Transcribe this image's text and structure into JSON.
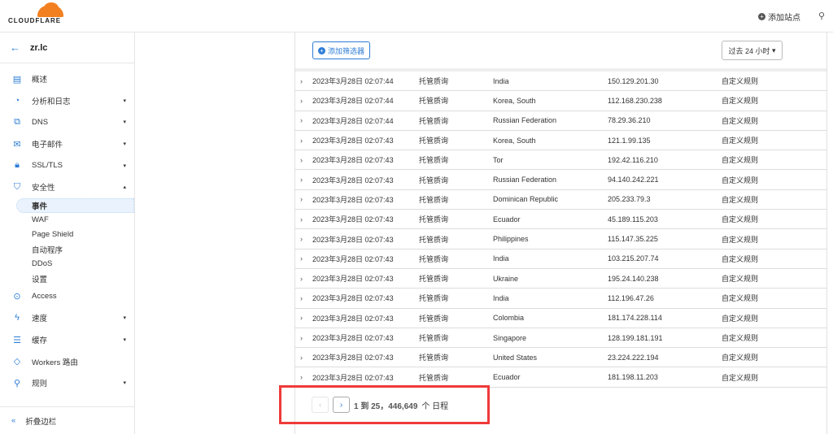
{
  "header": {
    "logo_text": "CLOUDFLARE",
    "add_site": "添加站点",
    "search_icon": "search-icon"
  },
  "sidebar": {
    "zone": "zr.lc",
    "items": [
      {
        "label": "概述",
        "icon": "document-icon",
        "caret": false
      },
      {
        "label": "分析和日志",
        "icon": "chart-pie-icon",
        "caret": true
      },
      {
        "label": "DNS",
        "icon": "network-icon",
        "caret": true
      },
      {
        "label": "电子邮件",
        "icon": "email-icon",
        "caret": true
      },
      {
        "label": "SSL/TLS",
        "icon": "lock-icon",
        "caret": true
      },
      {
        "label": "安全性",
        "icon": "shield-icon",
        "caret": true
      }
    ],
    "security_sub": [
      "事件",
      "WAF",
      "Page Shield",
      "自动程序",
      "DDoS",
      "设置"
    ],
    "items2": [
      {
        "label": "Access",
        "icon": "access-icon",
        "caret": false
      },
      {
        "label": "速度",
        "icon": "lightning-icon",
        "caret": true
      },
      {
        "label": "缓存",
        "icon": "cache-icon",
        "caret": true
      },
      {
        "label": "Workers 路由",
        "icon": "workers-icon",
        "caret": false
      },
      {
        "label": "规则",
        "icon": "rules-icon",
        "caret": true
      }
    ],
    "collapse": "折叠边栏"
  },
  "main": {
    "add_filter": "添加筛选器",
    "time_range": "过去 24 小时",
    "rows": [
      [
        "2023年3月28日 02:07:44",
        "托管质询",
        "India",
        "150.129.201.30",
        "自定义规则"
      ],
      [
        "2023年3月28日 02:07:44",
        "托管质询",
        "Korea, South",
        "112.168.230.238",
        "自定义规则"
      ],
      [
        "2023年3月28日 02:07:44",
        "托管质询",
        "Russian Federation",
        "78.29.36.210",
        "自定义规则"
      ],
      [
        "2023年3月28日 02:07:43",
        "托管质询",
        "Korea, South",
        "121.1.99.135",
        "自定义规则"
      ],
      [
        "2023年3月28日 02:07:43",
        "托管质询",
        "Tor",
        "192.42.116.210",
        "自定义规则"
      ],
      [
        "2023年3月28日 02:07:43",
        "托管质询",
        "Russian Federation",
        "94.140.242.221",
        "自定义规则"
      ],
      [
        "2023年3月28日 02:07:43",
        "托管质询",
        "Dominican Republic",
        "205.233.79.3",
        "自定义规则"
      ],
      [
        "2023年3月28日 02:07:43",
        "托管质询",
        "Ecuador",
        "45.189.115.203",
        "自定义规则"
      ],
      [
        "2023年3月28日 02:07:43",
        "托管质询",
        "Philippines",
        "115.147.35.225",
        "自定义规则"
      ],
      [
        "2023年3月28日 02:07:43",
        "托管质询",
        "India",
        "103.215.207.74",
        "自定义规则"
      ],
      [
        "2023年3月28日 02:07:43",
        "托管质询",
        "Ukraine",
        "195.24.140.238",
        "自定义规则"
      ],
      [
        "2023年3月28日 02:07:43",
        "托管质询",
        "India",
        "112.196.47.26",
        "自定义规则"
      ],
      [
        "2023年3月28日 02:07:43",
        "托管质询",
        "Colombia",
        "181.174.228.114",
        "自定义规则"
      ],
      [
        "2023年3月28日 02:07:43",
        "托管质询",
        "Singapore",
        "128.199.181.191",
        "自定义规则"
      ],
      [
        "2023年3月28日 02:07:43",
        "托管质询",
        "United States",
        "23.224.222.194",
        "自定义规则"
      ],
      [
        "2023年3月28日 02:07:43",
        "托管质询",
        "Ecuador",
        "181.198.11.203",
        "自定义规则"
      ]
    ],
    "pager": {
      "range": "1 到 25，446,649",
      "suffix": "个 日程"
    }
  }
}
